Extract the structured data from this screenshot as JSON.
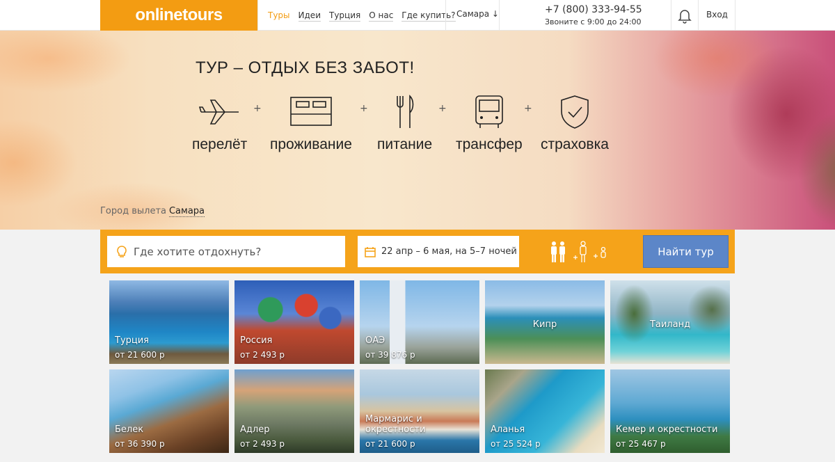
{
  "header": {
    "logo": "onlinetours",
    "nav": [
      "Туры",
      "Идеи",
      "Турция",
      "О нас",
      "Где купить?"
    ],
    "city": "Самара ↓",
    "phone": "+7 (800) 333-94-55",
    "hours": "Звоните с 9:00 до 24:00",
    "login": "Вход"
  },
  "hero": {
    "title": "ТУР – ОТДЫХ БЕЗ ЗАБОТ!",
    "features": [
      {
        "icon": "airplane-icon",
        "label": "перелёт"
      },
      {
        "icon": "bed-icon",
        "label": "проживание"
      },
      {
        "icon": "cutlery-icon",
        "label": "питание"
      },
      {
        "icon": "bus-icon",
        "label": "трансфер"
      },
      {
        "icon": "shield-check-icon",
        "label": "страховка"
      }
    ],
    "plus": "+",
    "depart_label": "Город вылета",
    "depart_city": "Самара"
  },
  "search": {
    "destination_placeholder": "Где хотите отдохнуть?",
    "dates": "22 апр – 6 мая, на 5–7 ночей",
    "find_button": "Найти тур"
  },
  "colors": {
    "accent": "#f39c12",
    "search_bg": "#f5a31a",
    "button": "#5c86c8"
  },
  "destinations": [
    {
      "name": "Турция",
      "price": "от 21 600 р"
    },
    {
      "name": "Россия",
      "price": "от 2 493 р"
    },
    {
      "name": "ОАЭ",
      "price": "от 39 876 р"
    },
    {
      "name": "Кипр",
      "price": ""
    },
    {
      "name": "Таиланд",
      "price": ""
    },
    {
      "name": "Белек",
      "price": "от 36 390 р"
    },
    {
      "name": "Адлер",
      "price": "от 2 493 р"
    },
    {
      "name": "Мармарис и окрестности",
      "price": "от 21 600 р"
    },
    {
      "name": "Аланья",
      "price": "от 25 524 р"
    },
    {
      "name": "Кемер и окрестности",
      "price": "от 25 467 р"
    }
  ]
}
